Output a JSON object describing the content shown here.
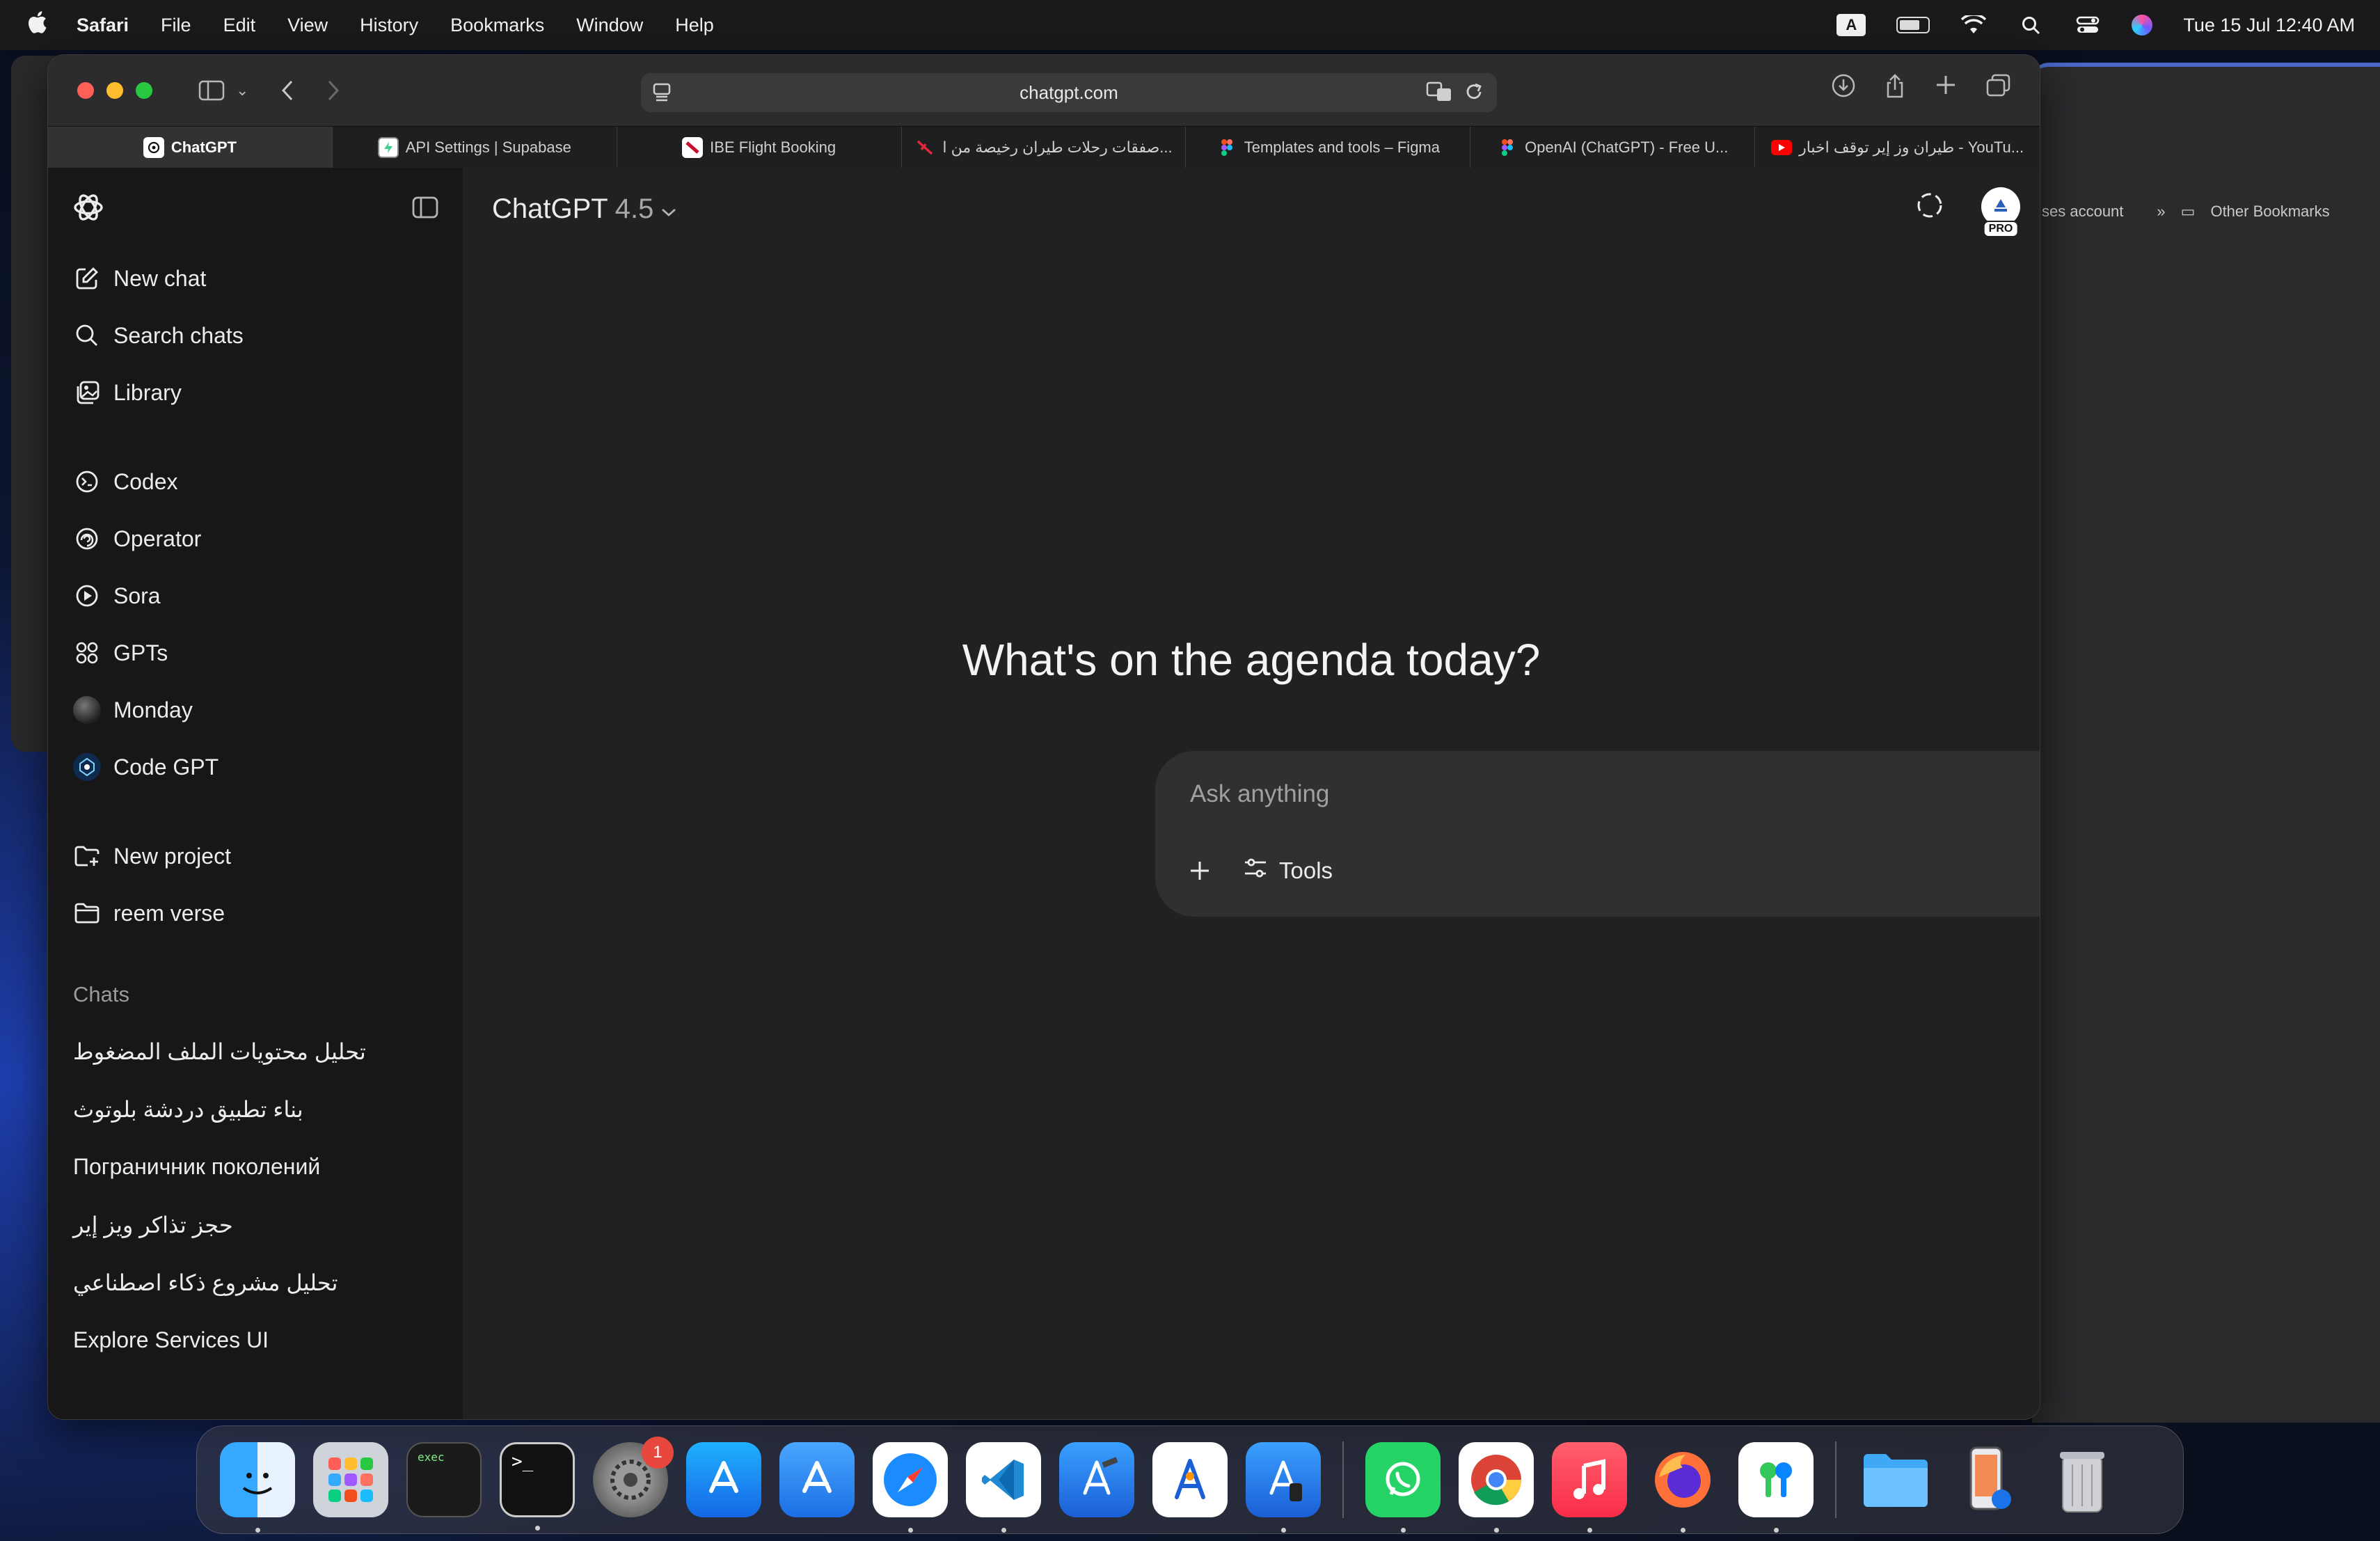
{
  "menubar": {
    "app": "Safari",
    "menus": [
      "File",
      "Edit",
      "View",
      "History",
      "Bookmarks",
      "Window",
      "Help"
    ],
    "keyboard": "A",
    "datetime": "Tue 15 Jul  12:40 AM"
  },
  "browser": {
    "url": "chatgpt.com",
    "tabs": [
      {
        "label": "ChatGPT",
        "icon": "chatgpt-icon",
        "active": true
      },
      {
        "label": "API Settings | Supabase",
        "icon": "supabase-icon"
      },
      {
        "label": "IBE Flight Booking",
        "icon": "flight-icon"
      },
      {
        "label": "صفقات رحلات طيران رخيصة من ا...",
        "icon": "flight-deals-icon"
      },
      {
        "label": "Templates and tools – Figma",
        "icon": "figma-icon"
      },
      {
        "label": "OpenAI (ChatGPT) - Free U...",
        "icon": "figma-icon"
      },
      {
        "label": "طيران وز إير توقف اخبار - YouTu...",
        "icon": "youtube-icon"
      }
    ]
  },
  "background_window": {
    "bookmark_partial": "ses account",
    "other_bookmarks": "Other Bookmarks"
  },
  "sidebar": {
    "actions": [
      {
        "label": "New chat",
        "icon": "edit-icon"
      },
      {
        "label": "Search chats",
        "icon": "search-icon"
      },
      {
        "label": "Library",
        "icon": "library-icon"
      }
    ],
    "tools": [
      {
        "label": "Codex",
        "icon": "codex-icon"
      },
      {
        "label": "Operator",
        "icon": "operator-icon"
      },
      {
        "label": "Sora",
        "icon": "sora-icon"
      },
      {
        "label": "GPTs",
        "icon": "gpts-icon"
      },
      {
        "label": "Monday",
        "icon": "monday-avatar-icon"
      },
      {
        "label": "Code GPT",
        "icon": "code-gpt-avatar-icon"
      }
    ],
    "projects": [
      {
        "label": "New project",
        "icon": "new-folder-icon"
      },
      {
        "label": "reem verse",
        "icon": "folder-icon"
      }
    ],
    "chats_title": "Chats",
    "chats": [
      "تحليل محتويات الملف المضغوط",
      "بناء تطبيق دردشة بلوتوث",
      "Пограничник поколений",
      "حجز تذاكر ويز إير",
      "تحليل مشروع ذكاء اصطناعي",
      "Explore Services UI"
    ]
  },
  "main": {
    "model_name": "ChatGPT",
    "model_version": "4.5",
    "avatar_badge": "PRO",
    "hero": "What's on the agenda today?",
    "composer": {
      "placeholder": "Ask anything",
      "tools_label": "Tools"
    }
  },
  "dock": {
    "apps": [
      "finder",
      "launchpad",
      "exec-terminal",
      "terminal",
      "system-settings",
      "app-store",
      "app-store-2",
      "safari",
      "vscode",
      "xcode",
      "instruments",
      "simulator",
      "whatsapp",
      "chrome",
      "music",
      "firefox",
      "passwords",
      "folder",
      "iphone-mirroring",
      "trash"
    ],
    "settings_badge": "1",
    "exec_label": "exec"
  }
}
